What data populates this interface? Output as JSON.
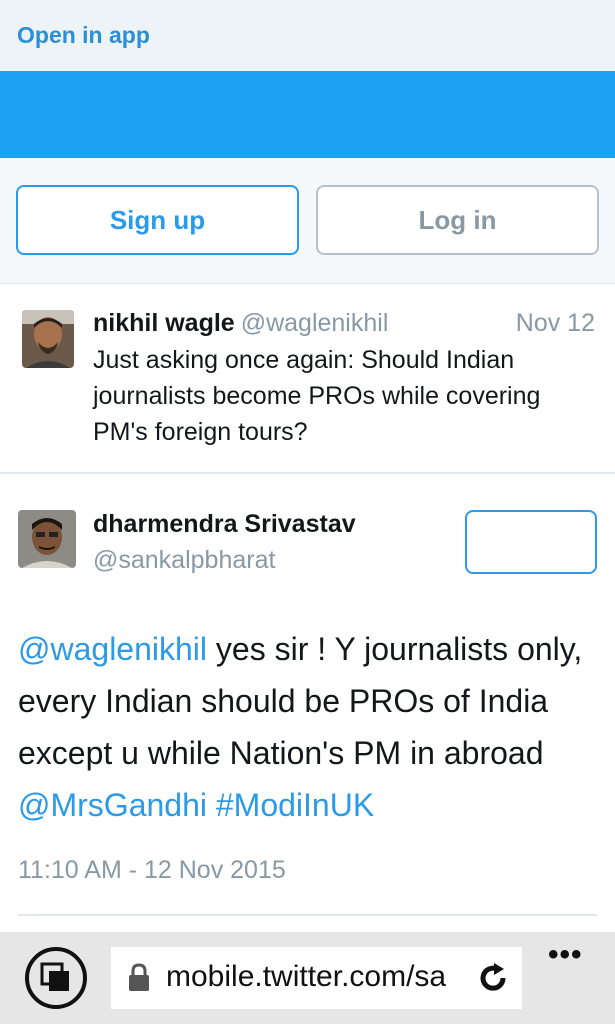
{
  "top_bar": {
    "open_in_app": "Open in app"
  },
  "auth": {
    "signup_label": "Sign up",
    "login_label": "Log in"
  },
  "reply_to_tweet": {
    "name": "nikhil wagle",
    "handle": "@waglenikhil",
    "date": "Nov 12",
    "text": "Just asking once again: Should Indian journalists become PROs while covering PM's foreign tours?"
  },
  "tweet": {
    "name": "dharmendra Srivastav",
    "handle": "@sankalpbharat",
    "text_parts": {
      "mention1": "@waglenikhil",
      "body": " yes sir ! Y journalists only, every Indian should be PROs of India except u while Nation's PM in abroad ",
      "mention2": "@MrsGandhi",
      "space": " ",
      "hashtag": "#ModiInUK"
    },
    "timestamp": "11:10 AM - 12 Nov 2015"
  },
  "browser": {
    "url": "mobile.twitter.com/sa",
    "more_label": "•••",
    "icons": [
      "tabs-icon",
      "lock-icon",
      "reload-icon",
      "more-icon"
    ]
  },
  "colors": {
    "twitter_blue": "#1da1f2",
    "link": "#2b9ae8",
    "muted": "#8899a6"
  }
}
